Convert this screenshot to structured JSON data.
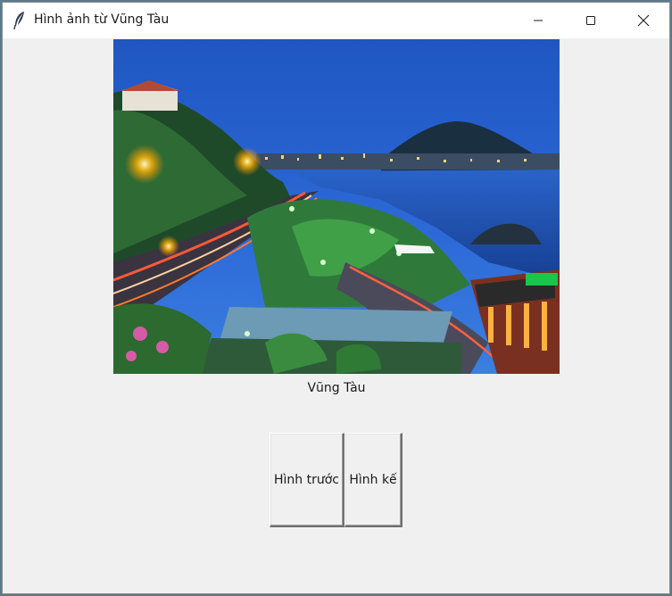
{
  "window": {
    "title": "Hình ảnh từ Vũng Tàu",
    "icon": "feather-icon",
    "controls": [
      "minimize-icon",
      "maximize-icon",
      "close-icon"
    ]
  },
  "photo": {
    "caption": "Vũng Tàu"
  },
  "buttons": {
    "prev_label": "Hình trước",
    "next_label": "Hình kế"
  }
}
